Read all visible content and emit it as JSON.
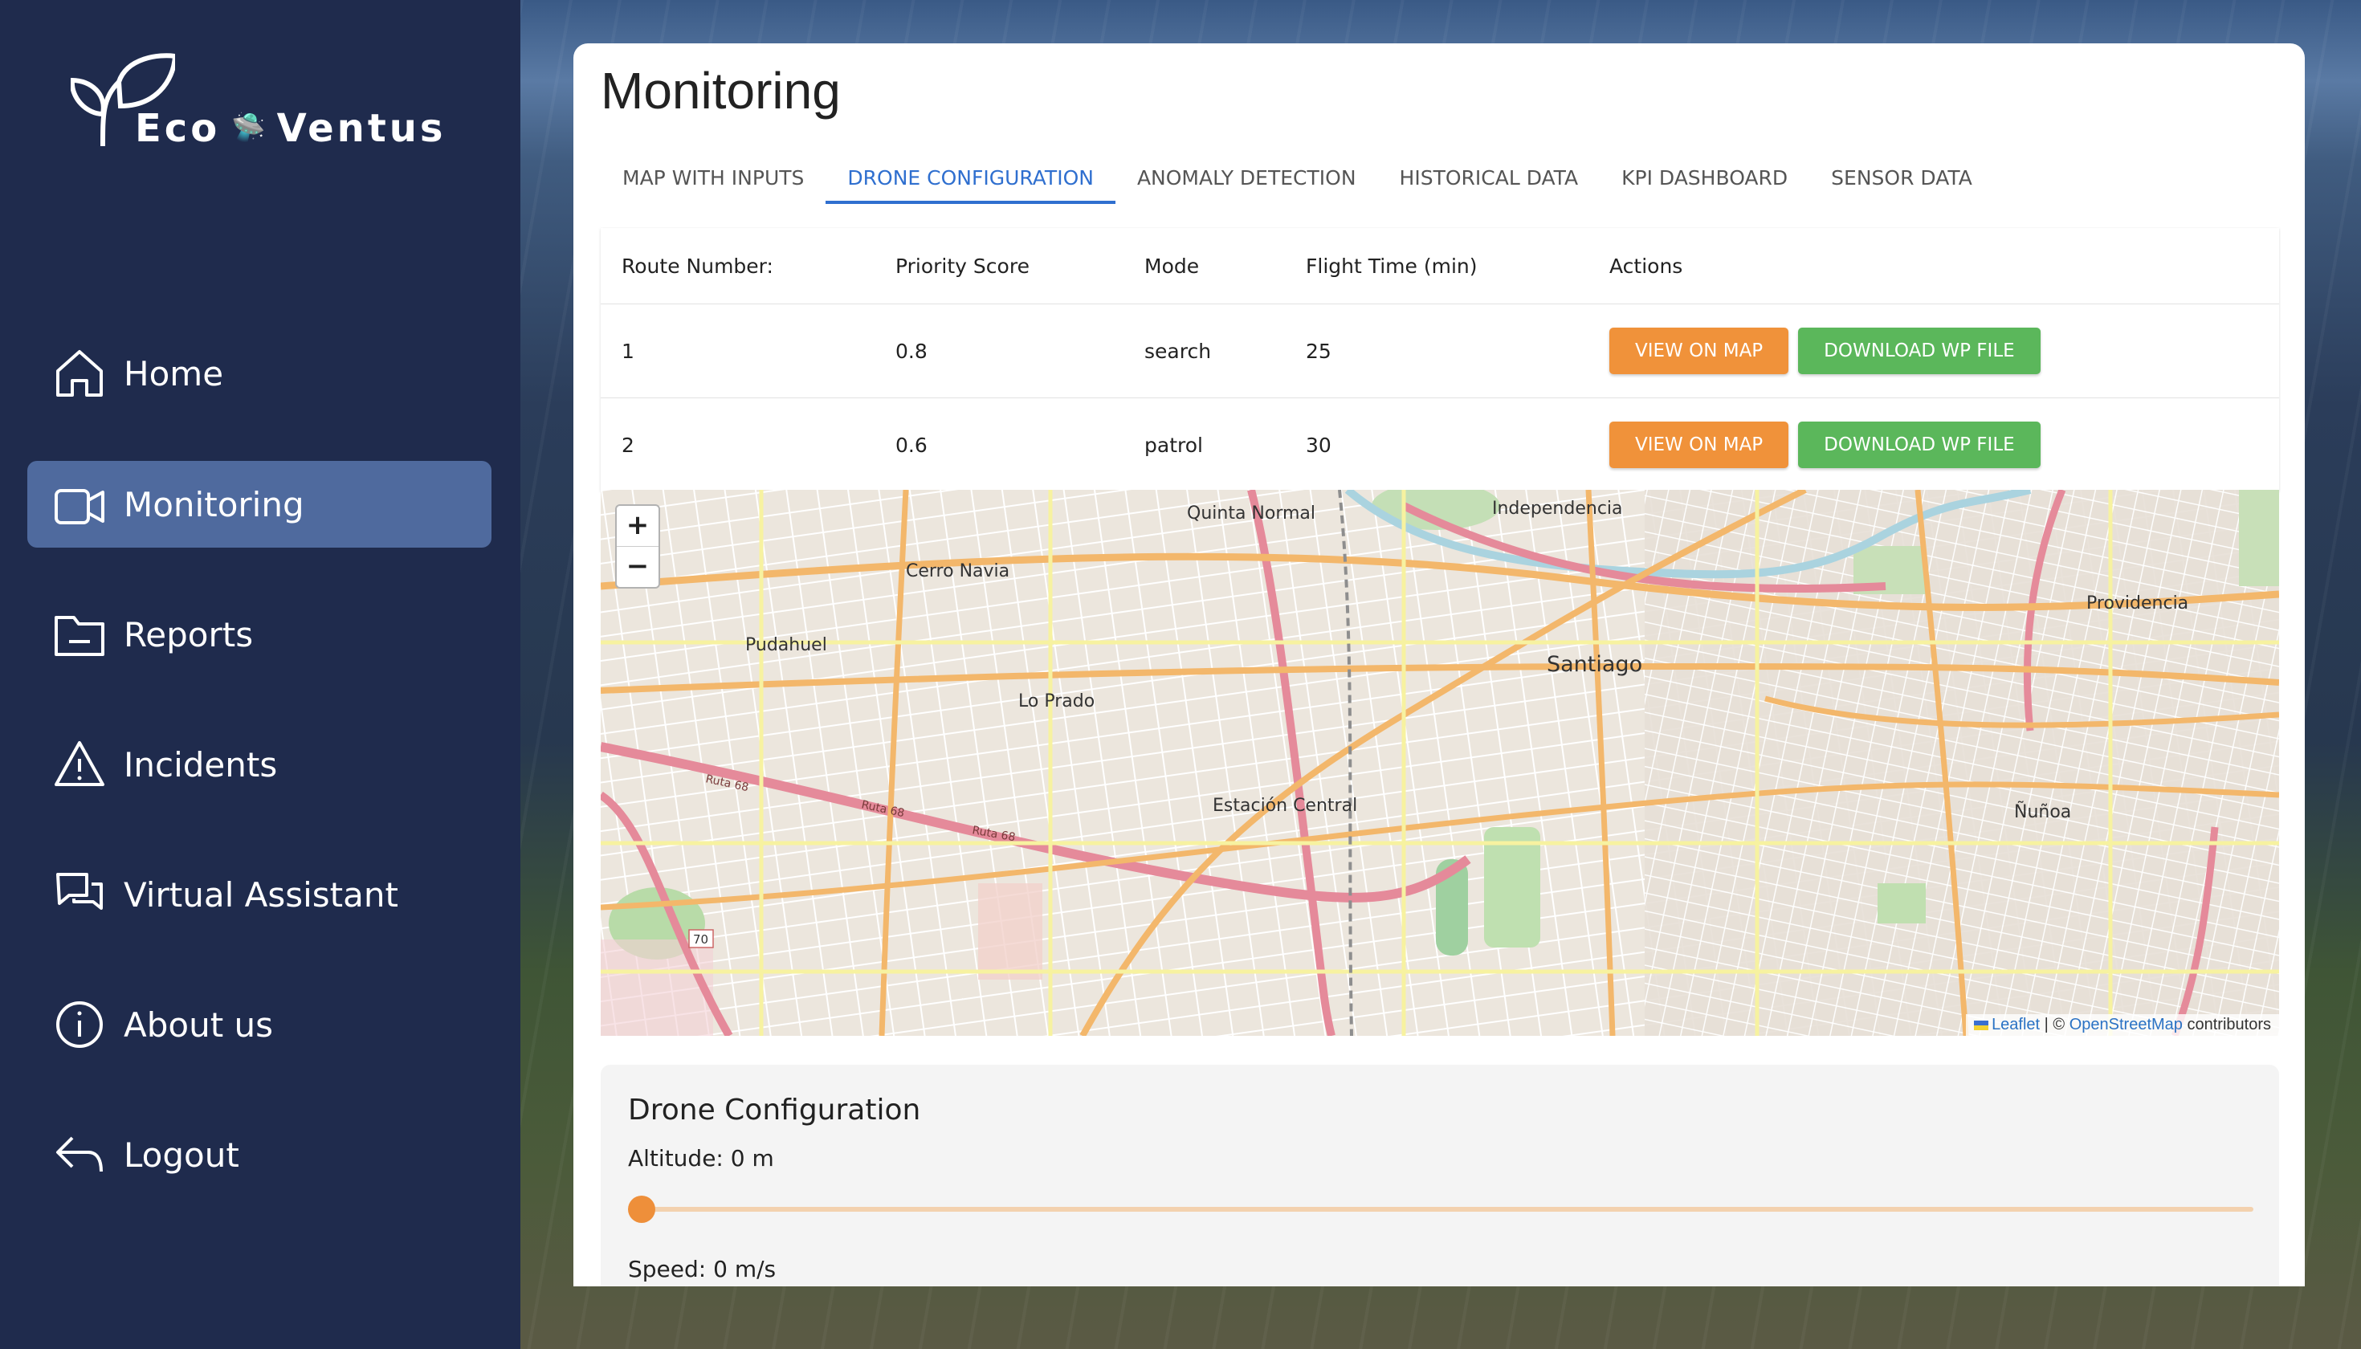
{
  "brand": {
    "name_part1": "Eco",
    "name_part2": "Ventus"
  },
  "sidebar": {
    "items": [
      {
        "label": "Home",
        "icon": "home-icon"
      },
      {
        "label": "Monitoring",
        "icon": "camera-icon",
        "active": true
      },
      {
        "label": "Reports",
        "icon": "folder-icon"
      },
      {
        "label": "Incidents",
        "icon": "warning-icon"
      },
      {
        "label": "Virtual Assistant",
        "icon": "chat-icon"
      },
      {
        "label": "About us",
        "icon": "info-icon"
      },
      {
        "label": "Logout",
        "icon": "logout-icon"
      }
    ]
  },
  "main": {
    "title": "Monitoring",
    "tabs": [
      {
        "label": "MAP WITH INPUTS"
      },
      {
        "label": "DRONE CONFIGURATION",
        "active": true
      },
      {
        "label": "ANOMALY DETECTION"
      },
      {
        "label": "HISTORICAL DATA"
      },
      {
        "label": "KPI DASHBOARD"
      },
      {
        "label": "SENSOR DATA"
      }
    ]
  },
  "routes": {
    "headers": [
      "Route Number:",
      "Priority Score",
      "Mode",
      "Flight Time (min)",
      "Actions"
    ],
    "rows": [
      {
        "route": "1",
        "priority": "0.8",
        "mode": "search",
        "flight_time": "25"
      },
      {
        "route": "2",
        "priority": "0.6",
        "mode": "patrol",
        "flight_time": "30"
      }
    ],
    "view_label": "VIEW ON MAP",
    "download_label": "DOWNLOAD WP FILE"
  },
  "map": {
    "zoom_in": "+",
    "zoom_out": "−",
    "attribution": {
      "leaflet": "Leaflet",
      "sep": " | © ",
      "osm": "OpenStreetMap",
      "suffix": " contributors"
    },
    "labels": {
      "quinta_normal": "Quinta Normal",
      "independencia": "Independencia",
      "cerro_navia": "Cerro Navia",
      "providencia": "Providencia",
      "pudahuel": "Pudahuel",
      "santiago": "Santiago",
      "lo_prado": "Lo Prado",
      "estacion_central": "Estación Central",
      "nunoa": "Ñuñoa",
      "ruta68": "Ruta 68",
      "r70": "70"
    }
  },
  "config": {
    "title": "Drone Configuration",
    "altitude_label": "Altitude: 0 m",
    "speed_label": "Speed: 0 m/s",
    "altitude_value": 0
  },
  "colors": {
    "accent": "#2f6fcf",
    "orange": "#f0923a",
    "green": "#5bb75b",
    "sidebar": "#1f2b4d",
    "active_nav": "#4f6a9e"
  }
}
